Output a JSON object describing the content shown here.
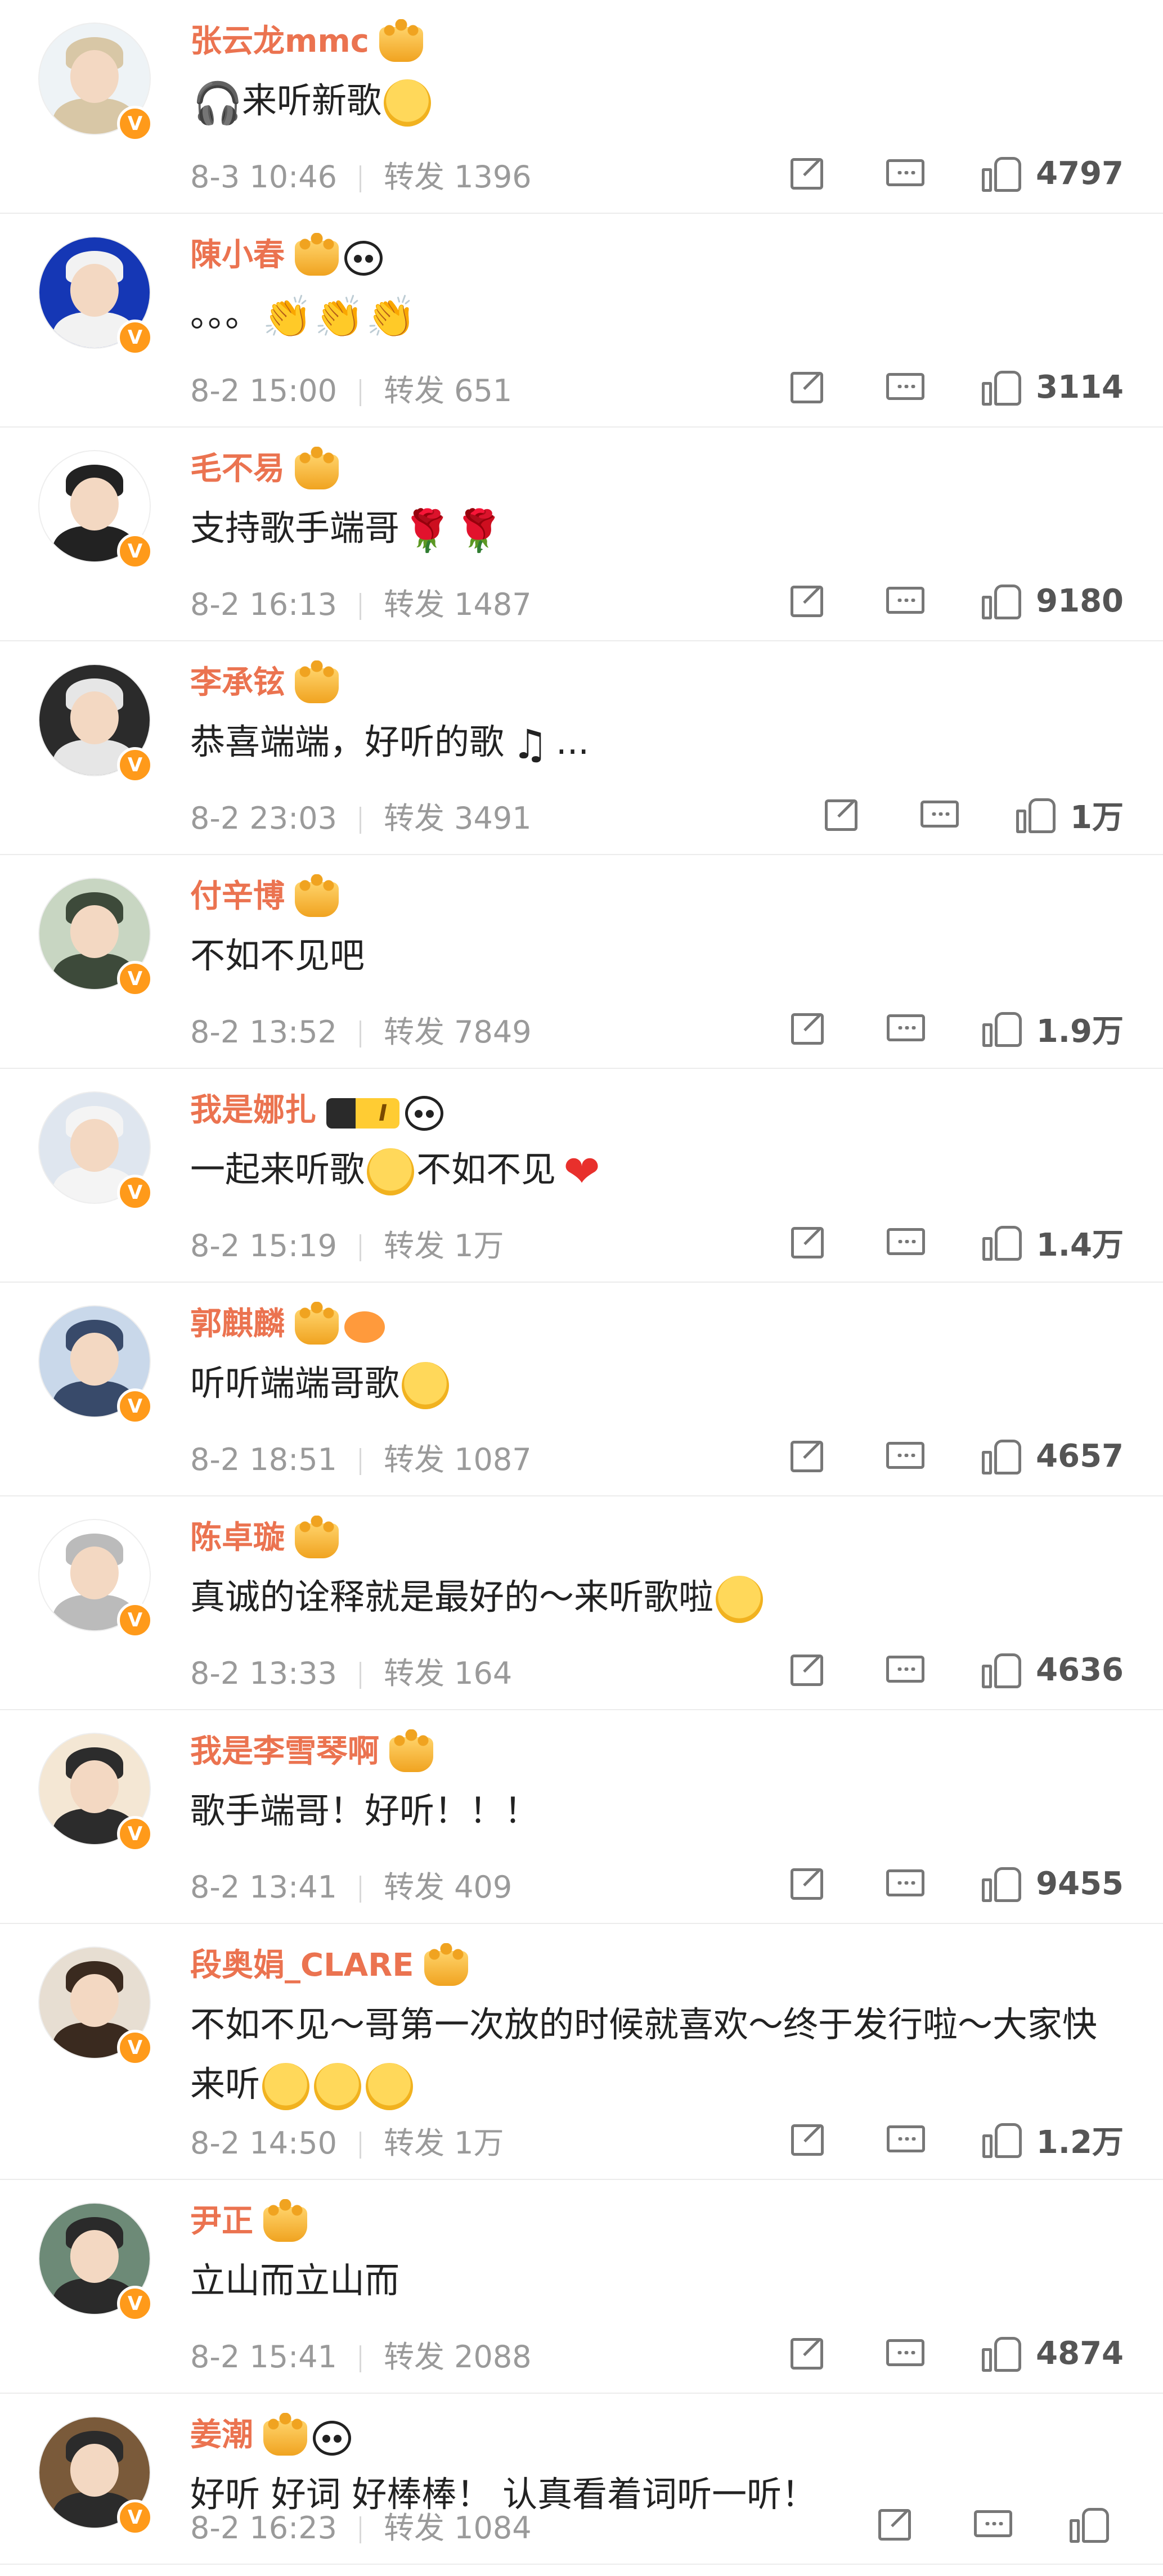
{
  "comments": [
    {
      "name": "张云龙mmc",
      "badges": [
        "crown"
      ],
      "text_parts": [
        {
          "emoji": "headphones-icon",
          "glyph": "🎧"
        },
        {
          "t": "来听新歌"
        },
        {
          "emoji": "shy-face-emoji"
        }
      ],
      "date": "8-3 10:46",
      "repost": "转发 1396",
      "likes": "4797"
    },
    {
      "name": "陳小春",
      "badges": [
        "crown",
        "panda"
      ],
      "text_parts": [
        {
          "t": "。。。"
        },
        {
          "emoji": "clap-emoji",
          "glyph": "👏"
        },
        {
          "emoji": "clap-emoji",
          "glyph": "👏"
        },
        {
          "emoji": "clap-emoji",
          "glyph": "👏"
        }
      ],
      "date": "8-2 15:00",
      "repost": "转发 651",
      "likes": "3114"
    },
    {
      "name": "毛不易",
      "badges": [
        "crown"
      ],
      "text_parts": [
        {
          "t": "支持歌手端哥"
        },
        {
          "emoji": "rose-emoji",
          "glyph": "🌹"
        },
        {
          "emoji": "rose-emoji",
          "glyph": "🌹"
        }
      ],
      "date": "8-2 16:13",
      "repost": "转发 1487",
      "likes": "9180"
    },
    {
      "name": "李承铉",
      "badges": [
        "crown"
      ],
      "text_parts": [
        {
          "t": "恭喜端端，好听的歌"
        },
        {
          "emoji": "music-note-emoji",
          "glyph": "♫"
        },
        {
          "t": "..."
        }
      ],
      "date": "8-2 23:03",
      "repost": "转发 3491",
      "likes": "1万"
    },
    {
      "name": "付辛博",
      "badges": [
        "crown"
      ],
      "text_parts": [
        {
          "t": "不如不见吧"
        }
      ],
      "date": "8-2 13:52",
      "repost": "转发 7849",
      "likes": "1.9万"
    },
    {
      "name": "我是娜扎",
      "badges": [
        "level",
        "panda"
      ],
      "level_text": "I",
      "text_parts": [
        {
          "t": "一起来听歌"
        },
        {
          "emoji": "sweat-face-emoji"
        },
        {
          "t": "不如不见"
        },
        {
          "emoji": "heart-emoji",
          "glyph": "❤"
        }
      ],
      "date": "8-2 15:19",
      "repost": "转发 1万",
      "likes": "1.4万"
    },
    {
      "name": "郭麒麟",
      "badges": [
        "crown",
        "fish"
      ],
      "text_parts": [
        {
          "t": "听听端端哥歌"
        },
        {
          "emoji": "hug-face-emoji"
        }
      ],
      "date": "8-2 18:51",
      "repost": "转发 1087",
      "likes": "4657"
    },
    {
      "name": "陈卓璇",
      "badges": [
        "crown"
      ],
      "text_parts": [
        {
          "t": "真诚的诠释就是最好的～来听歌啦"
        },
        {
          "emoji": "flower-face-emoji"
        }
      ],
      "date": "8-2 13:33",
      "repost": "转发 164",
      "likes": "4636"
    },
    {
      "name": "我是李雪琴啊",
      "badges": [
        "crown"
      ],
      "text_parts": [
        {
          "t": "歌手端哥！好听！！！"
        }
      ],
      "date": "8-2 13:41",
      "repost": "转发 409",
      "likes": "9455"
    },
    {
      "name": "段奥娟_CLARE",
      "badges": [
        "crown"
      ],
      "text_parts": [
        {
          "t": "不如不见～哥第一次放的时候就喜欢～终于发行啦～大家快来听"
        },
        {
          "emoji": "cry-laugh-emoji"
        },
        {
          "emoji": "cry-laugh-emoji"
        },
        {
          "emoji": "cry-laugh-emoji"
        }
      ],
      "date": "8-2 14:50",
      "repost": "转发 1万",
      "likes": "1.2万"
    },
    {
      "name": "尹正",
      "badges": [
        "crown"
      ],
      "text_parts": [
        {
          "t": "立山而立山而"
        }
      ],
      "date": "8-2 15:41",
      "repost": "转发 2088",
      "likes": "4874"
    },
    {
      "name": "姜潮",
      "badges": [
        "crown",
        "panda"
      ],
      "text_parts": [
        {
          "t": "好听 好词 好棒棒！ 认真看着词听一听！"
        }
      ],
      "date": "8-2 16:23",
      "repost": "转发 1084",
      "likes": ""
    }
  ],
  "verified_mark": "V",
  "colors": {
    "name": "#eb7350",
    "text": "#222222",
    "meta": "#9a9a9a",
    "divider": "#ececec",
    "vbadge": "#ff9a1a"
  }
}
